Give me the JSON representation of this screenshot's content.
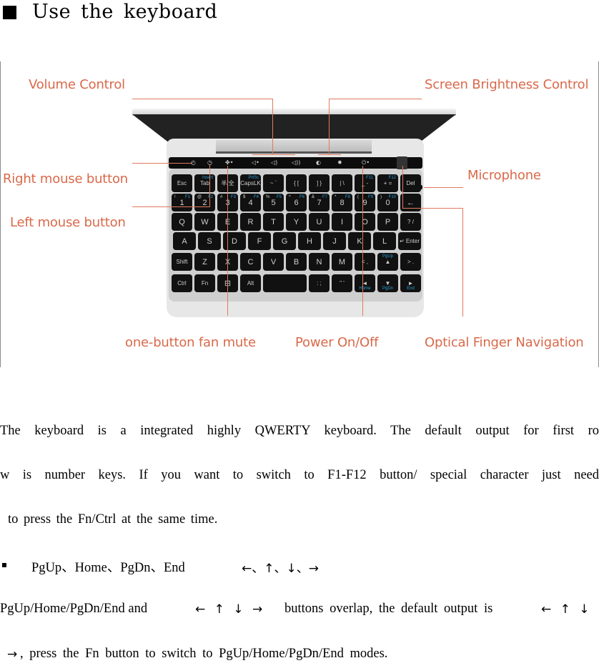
{
  "heading": {
    "bullet_icon": "black-square-bullet",
    "words": [
      "Use",
      "the",
      "keyboard"
    ]
  },
  "figure": {
    "accent_color": "#e07a5f",
    "callouts": {
      "volume_control": "Volume Control",
      "screen_brightness_control": "Screen Brightness Control",
      "right_mouse_button": "Right mouse button",
      "microphone": "Microphone",
      "left_mouse_button": "Left mouse button",
      "fan_mute": "one-button fan mute",
      "power": "Power On/Off",
      "optical_finger_navigation": "Optical Finger Navigation"
    },
    "touchbar_icons": [
      "left-click-icon",
      "right-click-icon",
      "fan-icon",
      "volume-mute-icon",
      "volume-down-icon",
      "volume-up-icon",
      "brightness-down-icon",
      "brightness-up-icon",
      "power-icon"
    ],
    "keyboard": {
      "row0": [
        {
          "main": "Esc",
          "sub": ""
        },
        {
          "main": "Tab",
          "sub": "Insert"
        },
        {
          "main": "半/全",
          "sub": ""
        },
        {
          "main": "CapsLK",
          "sub": "PrtSc"
        },
        {
          "main": "~ `",
          "sub": ""
        },
        {
          "main": "{ [",
          "sub": ""
        },
        {
          "main": "] }",
          "sub": ""
        },
        {
          "main": "| \\",
          "sub": ""
        },
        {
          "main": "_ -",
          "sub": "F11"
        },
        {
          "main": "+ =",
          "sub": "F12"
        },
        {
          "main": "Del",
          "sub": ""
        }
      ],
      "row1": [
        {
          "main": "1",
          "top": "!",
          "sub": "F1"
        },
        {
          "main": "2",
          "top": "@",
          "sub": "F2"
        },
        {
          "main": "3",
          "top": "#",
          "sub": "F3"
        },
        {
          "main": "4",
          "top": "$",
          "sub": "F4"
        },
        {
          "main": "5",
          "top": "%",
          "sub": "F5"
        },
        {
          "main": "6",
          "top": "^",
          "sub": "F6"
        },
        {
          "main": "7",
          "top": "&",
          "sub": "F7"
        },
        {
          "main": "8",
          "top": "*",
          "sub": "F8"
        },
        {
          "main": "9",
          "top": "(",
          "sub": "F9"
        },
        {
          "main": "0",
          "top": ")",
          "sub": "F10"
        },
        {
          "main": "←",
          "top": "",
          "sub": ""
        }
      ],
      "row2": [
        "Q",
        "W",
        "E",
        "R",
        "T",
        "Y",
        "U",
        "I",
        "O",
        "P",
        "? /"
      ],
      "row3": [
        "A",
        "S",
        "D",
        "F",
        "G",
        "H",
        "J",
        "K",
        "L",
        "↵ Enter"
      ],
      "row4": [
        "Shift",
        "Z",
        "X",
        "C",
        "V",
        "B",
        "N",
        "M",
        "< ,",
        "▲",
        "> ."
      ],
      "row4_fn": {
        "up_label": "PgUp"
      },
      "row5": [
        "Ctrl",
        "Fn",
        "⊞",
        "Alt",
        "",
        ": ;",
        "\" '",
        "◄",
        "▼",
        "►"
      ],
      "row5_fn": {
        "left_label": "Home",
        "down_label": "PgDn",
        "right_label": "End"
      }
    }
  },
  "body": {
    "paragraph1_line1": "The keyboard is a integrated highly QWERTY keyboard. The default output for first ro",
    "paragraph1_line2": "w is number keys. If you want to switch to F1-F12 button/ special character just need",
    "paragraph1_line3": "to press the Fn/Ctrl at the same time.",
    "bullet_item": {
      "bullet_icon": "small-square-bullet",
      "keys_text": "PgUp、Home、PgDn、End",
      "arrows_text": "←、↑、↓、→"
    },
    "paragraph2_line1_prefix": "PgUp/Home/PgDn/End and",
    "paragraph2_arrows": "← ↑ ↓ →",
    "paragraph2_line1_middle": "buttons overlap, the default output is",
    "paragraph2_arrows_tail": "← ↑ ↓",
    "paragraph2_line2_arrow": "→",
    "paragraph2_line2_text": ", press the Fn button to switch to PgUp/Home/PgDn/End modes."
  }
}
